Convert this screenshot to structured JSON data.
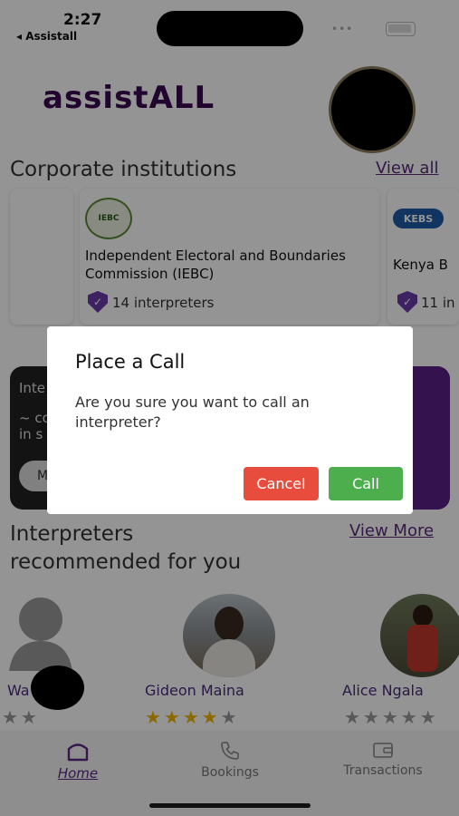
{
  "status_bar": {
    "time": "2:27",
    "back_app": "◂ Assistall",
    "signal": "•••"
  },
  "header": {
    "brand": "assistALL"
  },
  "corporate": {
    "title": "Corporate institutions",
    "view_all": "View all",
    "cards": [
      {
        "logo": "IEBC",
        "name": "Independent Electoral and Boundaries Commission (IEBC)",
        "interpreters": "14 interpreters"
      },
      {
        "logo": "KEBS",
        "name": "Kenya B",
        "interpreters": "11 in"
      }
    ]
  },
  "banner": {
    "line1": "Inte",
    "line2": "~ co",
    "line3": "in s",
    "button": "M"
  },
  "recommended": {
    "title_line1": "Interpreters",
    "title_line2": "recommended for you",
    "view_more": "View More",
    "people": [
      {
        "name": "Wa",
        "rating": 2
      },
      {
        "name": "Gideon Maina",
        "rating": 4
      },
      {
        "name": "Alice Ngala",
        "rating": 0
      }
    ]
  },
  "nav": {
    "home": "Home",
    "bookings": "Bookings",
    "transactions": "Transactions"
  },
  "dialog": {
    "title": "Place a  Call",
    "message": "Are you sure you want to call an interpreter?",
    "cancel": "Cancel",
    "call": "Call"
  },
  "colors": {
    "brand": "#3a0a52",
    "accent": "#6a3ca8",
    "cancel": "#e74c3c",
    "call": "#4cae4c"
  }
}
